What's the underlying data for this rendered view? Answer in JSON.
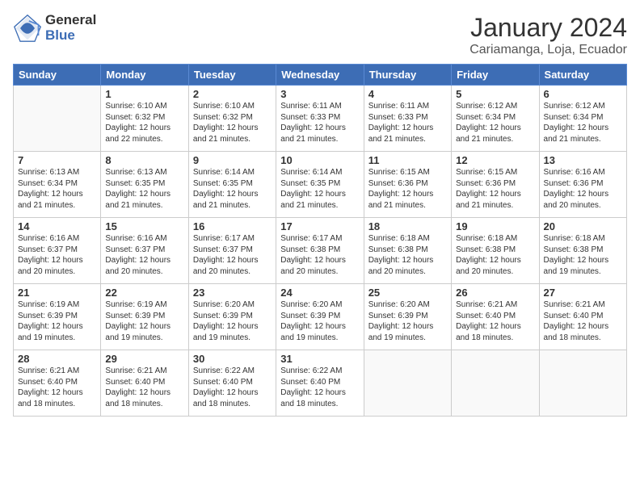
{
  "header": {
    "logo_line1": "General",
    "logo_line2": "Blue",
    "month_title": "January 2024",
    "subtitle": "Cariamanga, Loja, Ecuador"
  },
  "weekdays": [
    "Sunday",
    "Monday",
    "Tuesday",
    "Wednesday",
    "Thursday",
    "Friday",
    "Saturday"
  ],
  "weeks": [
    [
      {
        "day": "",
        "info": ""
      },
      {
        "day": "1",
        "info": "Sunrise: 6:10 AM\nSunset: 6:32 PM\nDaylight: 12 hours\nand 22 minutes."
      },
      {
        "day": "2",
        "info": "Sunrise: 6:10 AM\nSunset: 6:32 PM\nDaylight: 12 hours\nand 21 minutes."
      },
      {
        "day": "3",
        "info": "Sunrise: 6:11 AM\nSunset: 6:33 PM\nDaylight: 12 hours\nand 21 minutes."
      },
      {
        "day": "4",
        "info": "Sunrise: 6:11 AM\nSunset: 6:33 PM\nDaylight: 12 hours\nand 21 minutes."
      },
      {
        "day": "5",
        "info": "Sunrise: 6:12 AM\nSunset: 6:34 PM\nDaylight: 12 hours\nand 21 minutes."
      },
      {
        "day": "6",
        "info": "Sunrise: 6:12 AM\nSunset: 6:34 PM\nDaylight: 12 hours\nand 21 minutes."
      }
    ],
    [
      {
        "day": "7",
        "info": "Sunrise: 6:13 AM\nSunset: 6:34 PM\nDaylight: 12 hours\nand 21 minutes."
      },
      {
        "day": "8",
        "info": "Sunrise: 6:13 AM\nSunset: 6:35 PM\nDaylight: 12 hours\nand 21 minutes."
      },
      {
        "day": "9",
        "info": "Sunrise: 6:14 AM\nSunset: 6:35 PM\nDaylight: 12 hours\nand 21 minutes."
      },
      {
        "day": "10",
        "info": "Sunrise: 6:14 AM\nSunset: 6:35 PM\nDaylight: 12 hours\nand 21 minutes."
      },
      {
        "day": "11",
        "info": "Sunrise: 6:15 AM\nSunset: 6:36 PM\nDaylight: 12 hours\nand 21 minutes."
      },
      {
        "day": "12",
        "info": "Sunrise: 6:15 AM\nSunset: 6:36 PM\nDaylight: 12 hours\nand 21 minutes."
      },
      {
        "day": "13",
        "info": "Sunrise: 6:16 AM\nSunset: 6:36 PM\nDaylight: 12 hours\nand 20 minutes."
      }
    ],
    [
      {
        "day": "14",
        "info": "Sunrise: 6:16 AM\nSunset: 6:37 PM\nDaylight: 12 hours\nand 20 minutes."
      },
      {
        "day": "15",
        "info": "Sunrise: 6:16 AM\nSunset: 6:37 PM\nDaylight: 12 hours\nand 20 minutes."
      },
      {
        "day": "16",
        "info": "Sunrise: 6:17 AM\nSunset: 6:37 PM\nDaylight: 12 hours\nand 20 minutes."
      },
      {
        "day": "17",
        "info": "Sunrise: 6:17 AM\nSunset: 6:38 PM\nDaylight: 12 hours\nand 20 minutes."
      },
      {
        "day": "18",
        "info": "Sunrise: 6:18 AM\nSunset: 6:38 PM\nDaylight: 12 hours\nand 20 minutes."
      },
      {
        "day": "19",
        "info": "Sunrise: 6:18 AM\nSunset: 6:38 PM\nDaylight: 12 hours\nand 20 minutes."
      },
      {
        "day": "20",
        "info": "Sunrise: 6:18 AM\nSunset: 6:38 PM\nDaylight: 12 hours\nand 19 minutes."
      }
    ],
    [
      {
        "day": "21",
        "info": "Sunrise: 6:19 AM\nSunset: 6:39 PM\nDaylight: 12 hours\nand 19 minutes."
      },
      {
        "day": "22",
        "info": "Sunrise: 6:19 AM\nSunset: 6:39 PM\nDaylight: 12 hours\nand 19 minutes."
      },
      {
        "day": "23",
        "info": "Sunrise: 6:20 AM\nSunset: 6:39 PM\nDaylight: 12 hours\nand 19 minutes."
      },
      {
        "day": "24",
        "info": "Sunrise: 6:20 AM\nSunset: 6:39 PM\nDaylight: 12 hours\nand 19 minutes."
      },
      {
        "day": "25",
        "info": "Sunrise: 6:20 AM\nSunset: 6:39 PM\nDaylight: 12 hours\nand 19 minutes."
      },
      {
        "day": "26",
        "info": "Sunrise: 6:21 AM\nSunset: 6:40 PM\nDaylight: 12 hours\nand 18 minutes."
      },
      {
        "day": "27",
        "info": "Sunrise: 6:21 AM\nSunset: 6:40 PM\nDaylight: 12 hours\nand 18 minutes."
      }
    ],
    [
      {
        "day": "28",
        "info": "Sunrise: 6:21 AM\nSunset: 6:40 PM\nDaylight: 12 hours\nand 18 minutes."
      },
      {
        "day": "29",
        "info": "Sunrise: 6:21 AM\nSunset: 6:40 PM\nDaylight: 12 hours\nand 18 minutes."
      },
      {
        "day": "30",
        "info": "Sunrise: 6:22 AM\nSunset: 6:40 PM\nDaylight: 12 hours\nand 18 minutes."
      },
      {
        "day": "31",
        "info": "Sunrise: 6:22 AM\nSunset: 6:40 PM\nDaylight: 12 hours\nand 18 minutes."
      },
      {
        "day": "",
        "info": ""
      },
      {
        "day": "",
        "info": ""
      },
      {
        "day": "",
        "info": ""
      }
    ]
  ]
}
